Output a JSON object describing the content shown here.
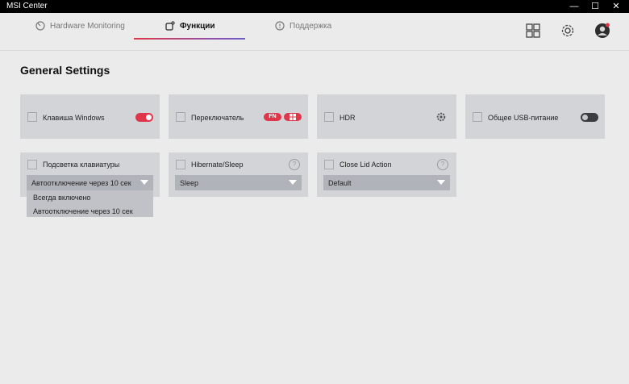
{
  "window": {
    "title": "MSI Center",
    "minimize": "—",
    "maximize": "☐",
    "close": "✕"
  },
  "tabs": [
    {
      "label": "Hardware Monitoring"
    },
    {
      "label": "Функции"
    },
    {
      "label": "Поддержка"
    }
  ],
  "page": {
    "title": "General Settings"
  },
  "cards": {
    "windows_key": {
      "label": "Клавиша Windows",
      "toggle": true
    },
    "switch": {
      "label": "Переключатель",
      "fn_badge": "FN"
    },
    "hdr": {
      "label": "HDR"
    },
    "usb_power": {
      "label": "Общее USB-питание",
      "toggle": false
    },
    "keyboard_backlight": {
      "label": "Подсветка клавиатуры",
      "value": "Автоотключение через 10 сек"
    },
    "hibernate": {
      "label": "Hibernate/Sleep",
      "value": "Sleep",
      "help": "?"
    },
    "close_lid": {
      "label": "Close Lid Action",
      "value": "Default",
      "help": "?"
    }
  },
  "dropdown_options": [
    "Всегда включено",
    "Автоотключение через 10 сек"
  ],
  "colors": {
    "accent": "#e0364a",
    "card": "#d3d4d8",
    "background": "#ebebeb"
  }
}
